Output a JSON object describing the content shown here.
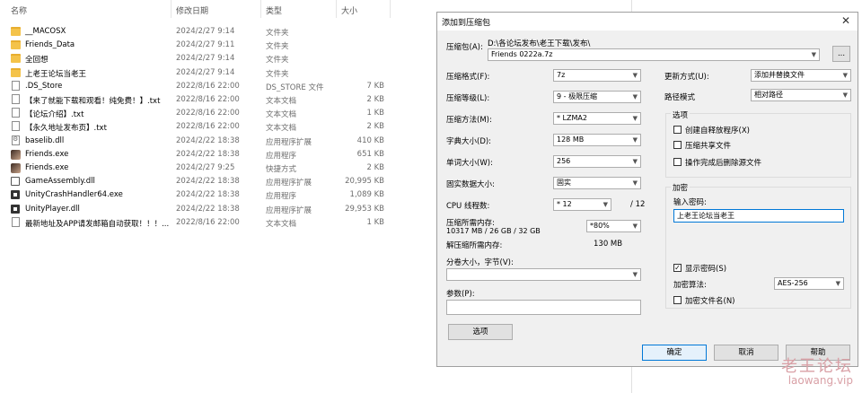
{
  "explorer": {
    "headers": {
      "name": "名称",
      "date": "修改日期",
      "type": "类型",
      "size": "大小"
    },
    "files": [
      {
        "icon": "folder-icon",
        "name": "__MACOSX",
        "date": "2024/2/27 9:14",
        "type": "文件夹",
        "size": ""
      },
      {
        "icon": "folder-icon",
        "name": "Friends_Data",
        "date": "2024/2/27 9:11",
        "type": "文件夹",
        "size": ""
      },
      {
        "icon": "folder-icon",
        "name": "全回想",
        "date": "2024/2/27 9:14",
        "type": "文件夹",
        "size": ""
      },
      {
        "icon": "folder-icon",
        "name": "上老王论坛当老王",
        "date": "2024/2/27 9:14",
        "type": "文件夹",
        "size": ""
      },
      {
        "icon": "file-icon",
        "name": ".DS_Store",
        "date": "2022/8/16 22:00",
        "type": "DS_STORE 文件",
        "size": "7 KB"
      },
      {
        "icon": "file-icon",
        "name": "【来了就能下载和观看！纯免费！】.txt",
        "date": "2022/8/16 22:00",
        "type": "文本文档",
        "size": "2 KB"
      },
      {
        "icon": "file-icon",
        "name": "【论坛介绍】.txt",
        "date": "2022/8/16 22:00",
        "type": "文本文档",
        "size": "1 KB"
      },
      {
        "icon": "file-icon",
        "name": "【永久地址发布页】.txt",
        "date": "2022/8/16 22:00",
        "type": "文本文档",
        "size": "2 KB"
      },
      {
        "icon": "dll-icon",
        "name": "baselib.dll",
        "date": "2024/2/22 18:38",
        "type": "应用程序扩展",
        "size": "410 KB"
      },
      {
        "icon": "exe-icon",
        "name": "Friends.exe",
        "date": "2024/2/22 18:38",
        "type": "应用程序",
        "size": "651 KB"
      },
      {
        "icon": "exe-icon",
        "name": "Friends.exe",
        "date": "2024/2/27 9:25",
        "type": "快捷方式",
        "size": "2 KB"
      },
      {
        "icon": "game-icon",
        "name": "GameAssembly.dll",
        "date": "2024/2/22 18:38",
        "type": "应用程序扩展",
        "size": "20,995 KB"
      },
      {
        "icon": "unity-icon",
        "name": "UnityCrashHandler64.exe",
        "date": "2024/2/22 18:38",
        "type": "应用程序",
        "size": "1,089 KB"
      },
      {
        "icon": "unity-icon",
        "name": "UnityPlayer.dll",
        "date": "2024/2/22 18:38",
        "type": "应用程序扩展",
        "size": "29,953 KB"
      },
      {
        "icon": "file-icon",
        "name": "最新地址及APP请发邮箱自动获取！！！...",
        "date": "2022/8/16 22:00",
        "type": "文本文档",
        "size": "1 KB"
      }
    ]
  },
  "dialog": {
    "title": "添加到压缩包",
    "close": "✕",
    "archive_label": "压缩包(A):",
    "archive_path": "D:\\各论坛发布\\老王下载\\发布\\",
    "archive_name": "Friends 0222a.7z",
    "browse": "...",
    "format_label": "压缩格式(F):",
    "format": "7z",
    "level_label": "压缩等级(L):",
    "level": "9 - 极限压缩",
    "method_label": "压缩方法(M):",
    "method": "* LZMA2",
    "dict_label": "字典大小(D):",
    "dict": "128 MB",
    "word_label": "单词大小(W):",
    "word": "256",
    "solid_label": "固实数据大小:",
    "solid": "固实",
    "threads_label": "CPU 线程数:",
    "threads": "* 12",
    "threads_max": "/ 12",
    "mem_label": "压缩所需内存:",
    "mem_detail": "10317 MB / 26 GB / 32 GB",
    "mem_pct": "*80%",
    "demem_label": "解压缩所需内存:",
    "demem_value": "130 MB",
    "split_label": "分卷大小，字节(V):",
    "params_label": "参数(P):",
    "options_button": "选项",
    "update_label": "更新方式(U):",
    "update": "添加并替换文件",
    "path_label": "路径模式",
    "path_mode": "相对路径",
    "opts_group": "选项",
    "opt_sfx": "创建自释放程序(X)",
    "opt_shared": "压缩共享文件",
    "opt_delete": "操作完成后删除源文件",
    "enc_group": "加密",
    "pw_label": "输入密码:",
    "pw_value": "上老王论坛当老王",
    "show_pw": "显示密码(S)",
    "show_pw_check": "✓",
    "enc_method_label": "加密算法:",
    "enc_method": "AES-256",
    "enc_names": "加密文件名(N)",
    "ok": "确定",
    "cancel": "取消",
    "help": "帮助"
  },
  "watermark": {
    "cn": "老王论坛",
    "url": "laowang.vip"
  }
}
